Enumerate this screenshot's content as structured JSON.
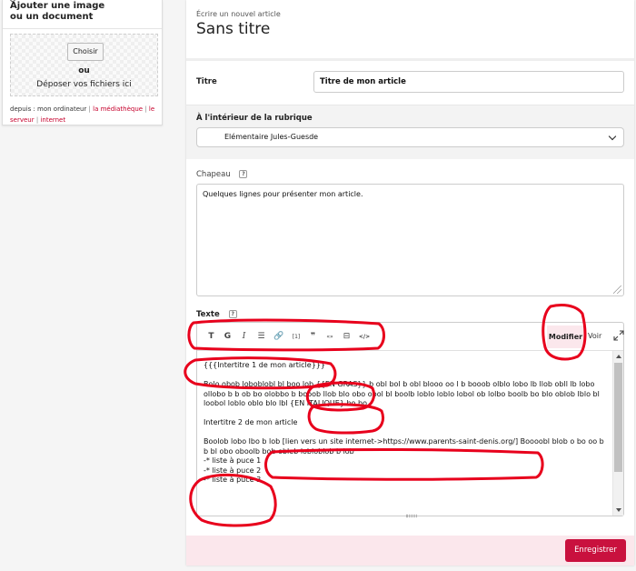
{
  "colors": {
    "accent": "#c9113e",
    "accent_light": "#fbe7ec",
    "annotation": "#e8001c"
  },
  "upload": {
    "title_line1": "Ajouter une image",
    "title_line2": "ou un document",
    "choose_button": "Choisir",
    "or_label": "ou",
    "drop_label": "Déposer vos fichiers ici",
    "sources_prefix": "depuis : mon ordinateur",
    "source_library": "la médiathèque",
    "source_server": "le serveur",
    "source_internet": "internet",
    "separator": "|"
  },
  "article": {
    "subtitle": "Écrire un nouvel article",
    "page_title": "Sans titre"
  },
  "form": {
    "titre_label": "Titre",
    "titre_value": "Titre de mon article",
    "rubrique_label": "À l'intérieur de la rubrique",
    "rubrique_value": "Elémentaire Jules-Guesde",
    "chapeau_label": "Chapeau",
    "help_glyph": "?",
    "chapeau_value": "Quelques lignes pour présenter mon article.",
    "texte_label": "Texte"
  },
  "toolbar": {
    "buttons": [
      {
        "name": "typo-button",
        "glyph": "T"
      },
      {
        "name": "bold-button",
        "glyph": "G"
      },
      {
        "name": "italic-button",
        "glyph": "I"
      },
      {
        "name": "list-button",
        "glyph": "☰"
      },
      {
        "name": "link-button",
        "glyph": "🔗"
      },
      {
        "name": "footnote-button",
        "glyph": "[1]"
      },
      {
        "name": "quote-button",
        "glyph": "❞"
      },
      {
        "name": "guillemets-button",
        "glyph": "«»"
      },
      {
        "name": "insert-button",
        "glyph": "⊟"
      },
      {
        "name": "code-button",
        "glyph": "</>"
      }
    ],
    "modifier_label": "Modifier",
    "voir_label": "Voir",
    "expand_icon": "expand-icon"
  },
  "editor": {
    "line_heading1": "{{{Intertitre 1 de mon article}}}",
    "para1": "Bolo obob loboblobl bl boo lob {{EN GRAS}} b obl bol b obl blooo oo l b booob olblo lobo lb llob obll lb lobo ollobo b b ob bo olobbo b booob llob blo obo obol bl boolb loblo loblo lobol ob lolbo boolb bo blo oblob lblo bl loobol loblo oblo blo lbl {EN ITALIQUE} bo bo.",
    "line_heading2": "Intertitre 2 de mon article",
    "para2": "Boolob lobo lbo b lob [lien vers un site internet->https://www.parents-saint-denis.org/] Boooobl blob o bo oo b b bl obo oboolb bob obleb lobloblob b lob",
    "bullets": [
      "-* liste à puce 1",
      "-* liste à puce 2",
      "-* liste à puce 3"
    ]
  },
  "footer": {
    "save_label": "Enregistrer"
  }
}
